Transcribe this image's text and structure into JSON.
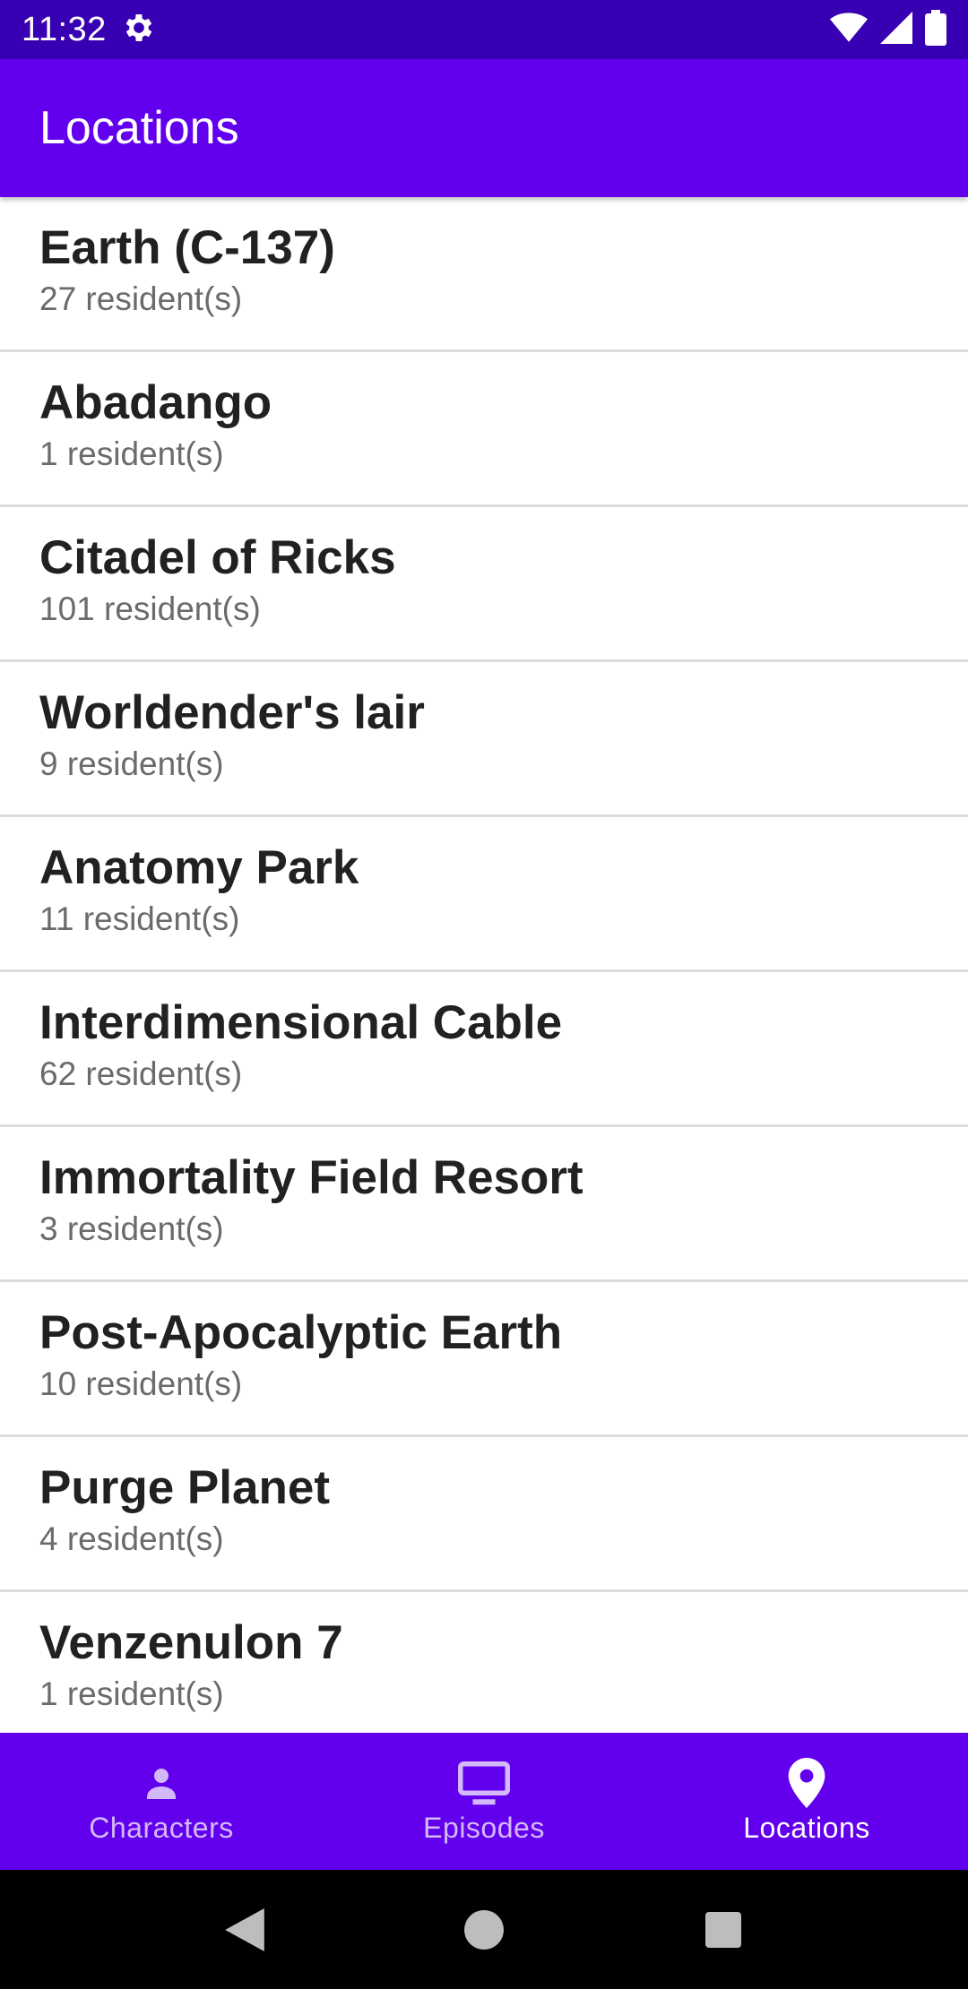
{
  "status_bar": {
    "time": "11:32",
    "icons": [
      "settings-icon",
      "wifi-icon",
      "signal-icon",
      "battery-icon"
    ]
  },
  "app_bar": {
    "title": "Locations"
  },
  "locations": [
    {
      "name": "Earth (C-137)",
      "residents": "27 resident(s)"
    },
    {
      "name": "Abadango",
      "residents": "1 resident(s)"
    },
    {
      "name": "Citadel of Ricks",
      "residents": "101 resident(s)"
    },
    {
      "name": "Worldender's lair",
      "residents": "9 resident(s)"
    },
    {
      "name": "Anatomy Park",
      "residents": "11 resident(s)"
    },
    {
      "name": "Interdimensional Cable",
      "residents": "62 resident(s)"
    },
    {
      "name": "Immortality Field Resort",
      "residents": "3 resident(s)"
    },
    {
      "name": "Post-Apocalyptic Earth",
      "residents": "10 resident(s)"
    },
    {
      "name": "Purge Planet",
      "residents": "4 resident(s)"
    },
    {
      "name": "Venzenulon 7",
      "residents": "1 resident(s)"
    }
  ],
  "bottom_nav": {
    "items": [
      {
        "label": "Characters",
        "icon": "person-icon",
        "active": false
      },
      {
        "label": "Episodes",
        "icon": "tv-icon",
        "active": false
      },
      {
        "label": "Locations",
        "icon": "location-pin-icon",
        "active": true
      }
    ]
  },
  "system_nav": {
    "buttons": [
      "back-icon",
      "home-icon",
      "recents-icon"
    ]
  },
  "colors": {
    "status_bar": "#3700b3",
    "primary": "#6200ee",
    "item_title": "#212121",
    "item_subtitle": "#6b6b6b",
    "divider": "#dcdcdc"
  }
}
